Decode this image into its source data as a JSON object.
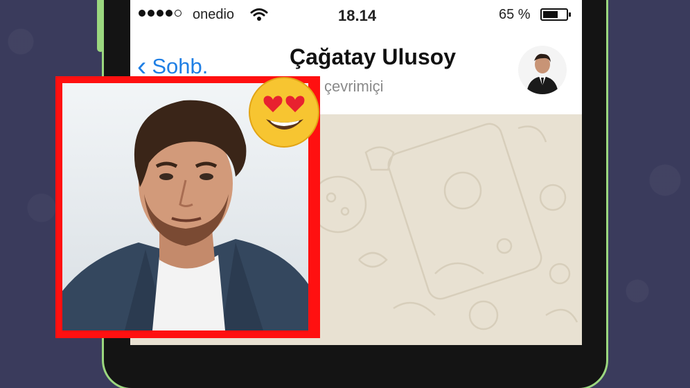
{
  "status_bar": {
    "carrier": "onedio",
    "time": "18.14",
    "battery_percent": "65 %",
    "battery_level": 0.65
  },
  "nav": {
    "back_label": "Sohb.",
    "contact_name": "Çağatay Ulusoy",
    "contact_status": "çevrimiçi"
  },
  "colors": {
    "accent": "#1f7fe5",
    "frame": "#ff1010",
    "phone_outline": "#9bd77f",
    "background": "#3a3b5c"
  },
  "icons": [
    "signal-dots-icon",
    "wifi-icon",
    "battery-icon",
    "chevron-left-icon",
    "heart-eyes-emoji-icon"
  ]
}
